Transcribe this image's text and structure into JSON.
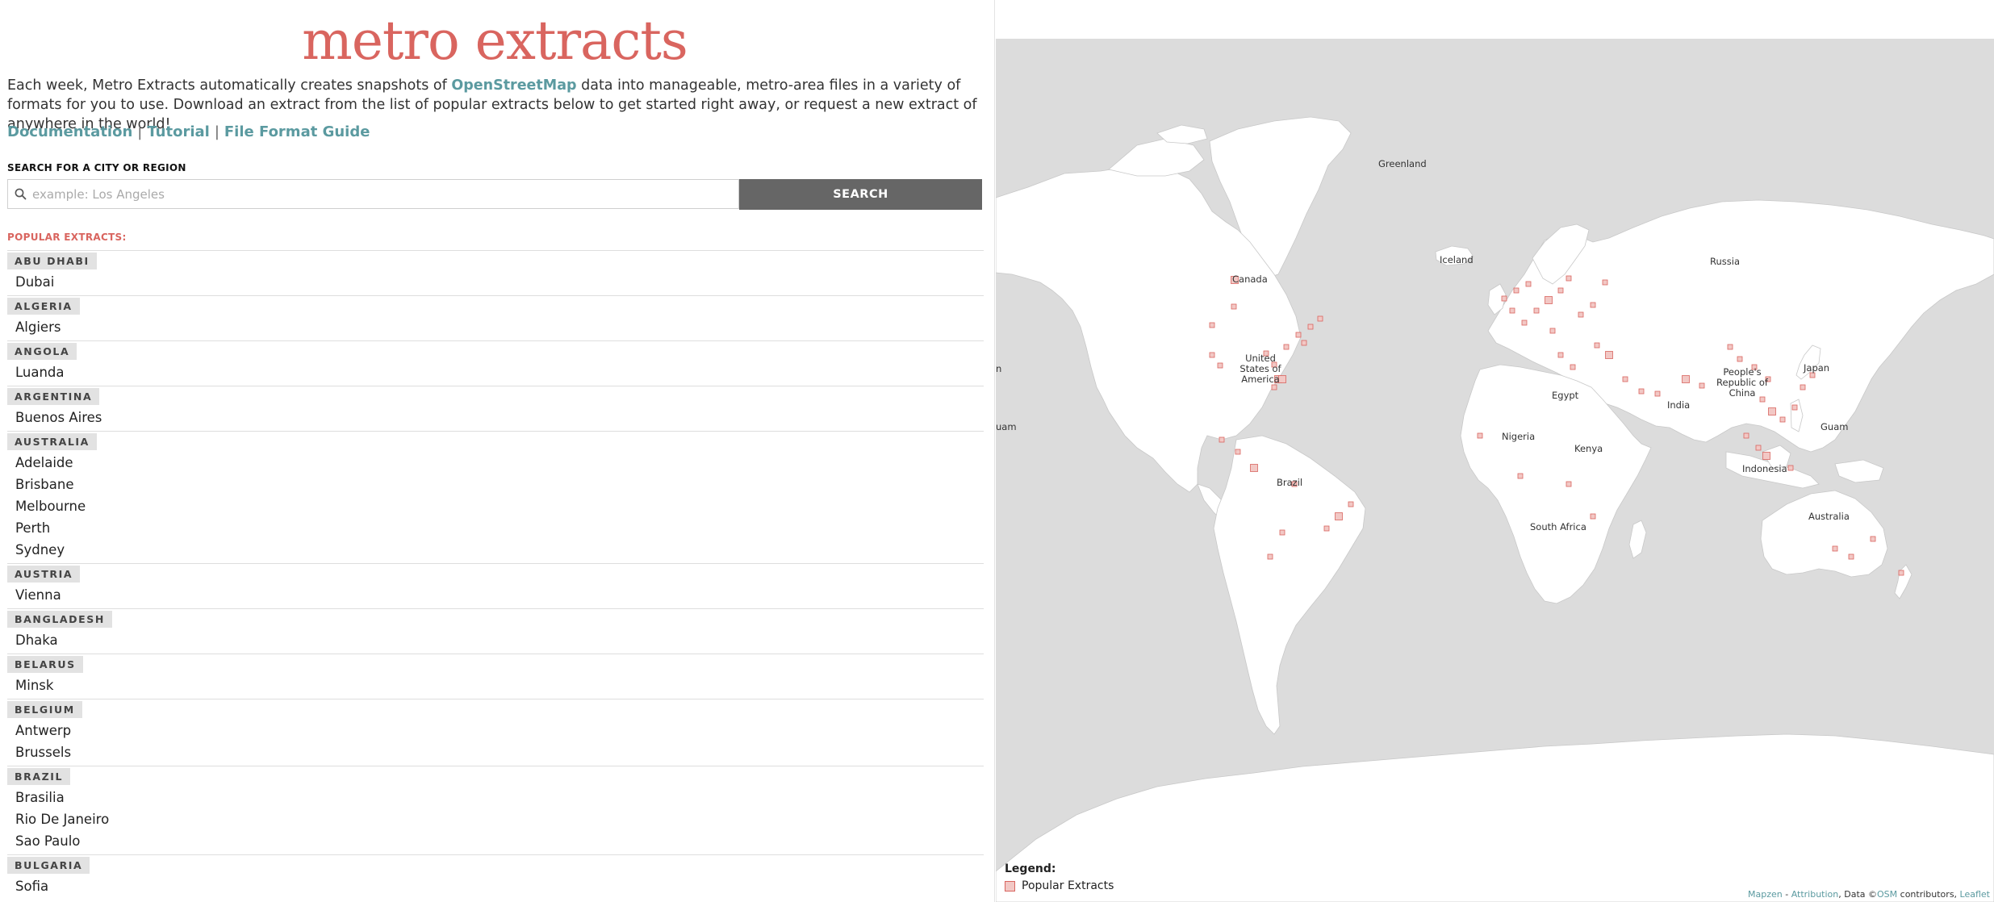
{
  "header": {
    "title": "metro extracts",
    "intro_before": "Each week, Metro Extracts automatically creates snapshots of ",
    "intro_link": "OpenStreetMap",
    "intro_after": " data into manageable, metro-area files in a variety of formats for you to use. Download an extract from the list of popular extracts below to get started right away, or request a new extract of anywhere in the world!",
    "links": [
      "Documentation",
      "Tutorial",
      "File Format Guide"
    ],
    "separator": "|"
  },
  "search": {
    "label": "SEARCH FOR A CITY OR REGION",
    "placeholder": "example: Los Angeles",
    "value": "",
    "button_label": "SEARCH"
  },
  "extracts": {
    "label": "POPULAR EXTRACTS:",
    "countries": [
      {
        "name": "ABU DHABI",
        "cities": [
          "Dubai"
        ]
      },
      {
        "name": "ALGERIA",
        "cities": [
          "Algiers"
        ]
      },
      {
        "name": "ANGOLA",
        "cities": [
          "Luanda"
        ]
      },
      {
        "name": "ARGENTINA",
        "cities": [
          "Buenos Aires"
        ]
      },
      {
        "name": "AUSTRALIA",
        "cities": [
          "Adelaide",
          "Brisbane",
          "Melbourne",
          "Perth",
          "Sydney"
        ]
      },
      {
        "name": "AUSTRIA",
        "cities": [
          "Vienna"
        ]
      },
      {
        "name": "BANGLADESH",
        "cities": [
          "Dhaka"
        ]
      },
      {
        "name": "BELARUS",
        "cities": [
          "Minsk"
        ]
      },
      {
        "name": "BELGIUM",
        "cities": [
          "Antwerp",
          "Brussels"
        ]
      },
      {
        "name": "BRAZIL",
        "cities": [
          "Brasilia",
          "Rio De Janeiro",
          "Sao Paulo"
        ]
      },
      {
        "name": "BULGARIA",
        "cities": [
          "Sofia"
        ]
      }
    ]
  },
  "map": {
    "labels": {
      "greenland": "Greenland",
      "iceland": "Iceland",
      "canada": "Canada",
      "russia": "Russia",
      "usa": "United States of America",
      "china": "People's Republic of China",
      "japan": "Japan",
      "egypt": "Egypt",
      "india": "India",
      "nigeria": "Nigeria",
      "kenya": "Kenya",
      "guam": "Guam",
      "guam_left": "uam",
      "left_edge": "n",
      "brazil": "Brazil",
      "indonesia": "Indonesia",
      "south_africa": "South Africa",
      "australia": "Australia"
    },
    "colors": {
      "ocean": "#dcdcdc",
      "land": "#ffffff",
      "border": "#c8c8c8",
      "marker_fill": "#f2c8c5",
      "marker_stroke": "#d9655f"
    },
    "legend": {
      "title": "Legend:",
      "item": "Popular Extracts"
    },
    "attribution": {
      "mapzen": "Mapzen",
      "dash": " - ",
      "attribution_link": "Attribution",
      "data_text": ", Data ©",
      "osm": "OSM",
      "contributors": " contributors, ",
      "leaflet": "Leaflet"
    }
  }
}
